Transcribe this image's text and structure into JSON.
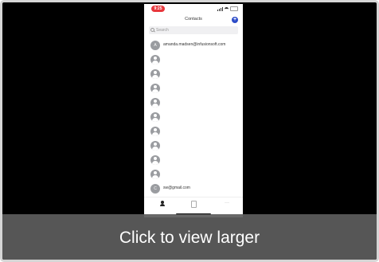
{
  "status_bar": {
    "time": "9:25"
  },
  "nav": {
    "title": "Contacts",
    "add_label": "+"
  },
  "search": {
    "placeholder": "Search"
  },
  "contacts": [
    {
      "initial": "A",
      "name": "amanda.madsen@infusionsoft.com"
    },
    {
      "initial": "",
      "name": ""
    },
    {
      "initial": "",
      "name": ""
    },
    {
      "initial": "",
      "name": ""
    },
    {
      "initial": "",
      "name": ""
    },
    {
      "initial": "",
      "name": ""
    },
    {
      "initial": "",
      "name": ""
    },
    {
      "initial": "",
      "name": ""
    },
    {
      "initial": "",
      "name": ""
    },
    {
      "initial": "",
      "name": ""
    },
    {
      "initial": "C",
      "name": "sw@gmail.com"
    }
  ],
  "tab_bar": {
    "more_label": "···"
  },
  "caption": {
    "text": "Click to view larger"
  },
  "colors": {
    "background": "#000000",
    "accent": "#2d4cc8",
    "time_pill": "#e8373c",
    "avatar": "#9a9ca0",
    "caption_bar": "#5c5c5c"
  },
  "icons": [
    "search-icon",
    "person-icon",
    "document-icon",
    "more-icon",
    "signal-icon",
    "wifi-icon",
    "battery-icon"
  ]
}
